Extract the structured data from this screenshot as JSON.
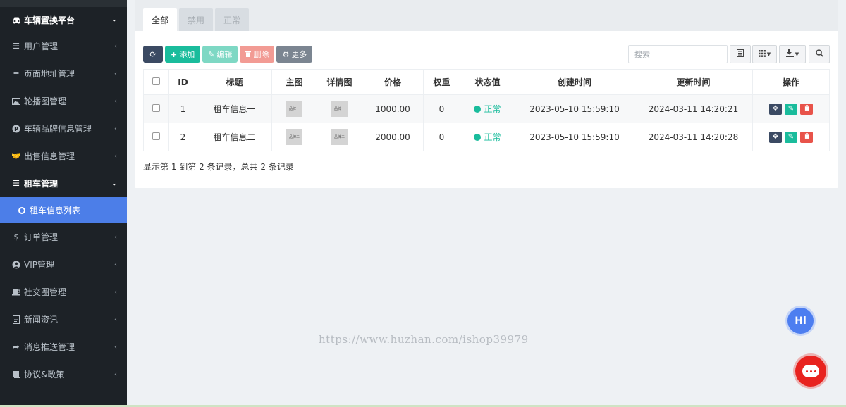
{
  "sidebar": {
    "header": {
      "label": "车辆置换平台",
      "icon": "car-icon"
    },
    "items": [
      {
        "label": "用户管理",
        "icon": "list-icon"
      },
      {
        "label": "页面地址管理",
        "icon": "bars-icon"
      },
      {
        "label": "轮播图管理",
        "icon": "image-icon"
      },
      {
        "label": "车辆品牌信息管理",
        "icon": "parking-icon"
      },
      {
        "label": "出售信息管理",
        "icon": "handshake-icon"
      },
      {
        "label": "租车管理",
        "icon": "list-icon"
      },
      {
        "label": "租车信息列表",
        "icon": "circle-icon"
      },
      {
        "label": "订单管理",
        "icon": "dollar-icon"
      },
      {
        "label": "VIP管理",
        "icon": "user-circle-icon"
      },
      {
        "label": "社交圈管理",
        "icon": "coffee-icon"
      },
      {
        "label": "新闻资讯",
        "icon": "document-icon"
      },
      {
        "label": "消息推送管理",
        "icon": "share-icon"
      },
      {
        "label": "协议&政策",
        "icon": "book-icon"
      }
    ]
  },
  "tabs": [
    "全部",
    "禁用",
    "正常"
  ],
  "toolbar": {
    "add": "添加",
    "edit": "编辑",
    "delete": "删除",
    "more": "更多",
    "search_placeholder": "搜索"
  },
  "table": {
    "columns": [
      "ID",
      "标题",
      "主图",
      "详情图",
      "价格",
      "权重",
      "状态值",
      "创建时间",
      "更新时间",
      "操作"
    ],
    "rows": [
      {
        "id": "1",
        "title": "租车信息一",
        "thumb_main": "品牌一",
        "thumb_detail": "品牌一",
        "price": "1000.00",
        "weight": "0",
        "status": "正常",
        "created": "2023-05-10 15:59:10",
        "updated": "2024-03-11 14:20:21"
      },
      {
        "id": "2",
        "title": "租车信息二",
        "thumb_main": "品牌二",
        "thumb_detail": "品牌二",
        "price": "2000.00",
        "weight": "0",
        "status": "正常",
        "created": "2023-05-10 15:59:10",
        "updated": "2024-03-11 14:20:28"
      }
    ]
  },
  "pager_text": "显示第 1 到第 2 条记录，总共 2 条记录",
  "watermark": "https://www.huzhan.com/ishop39979",
  "hi_label": "Hi",
  "colors": {
    "sidebar_bg": "#1d2227",
    "active": "#4c7ee8",
    "primary": "#1abc9c",
    "danger": "#e8534a"
  }
}
